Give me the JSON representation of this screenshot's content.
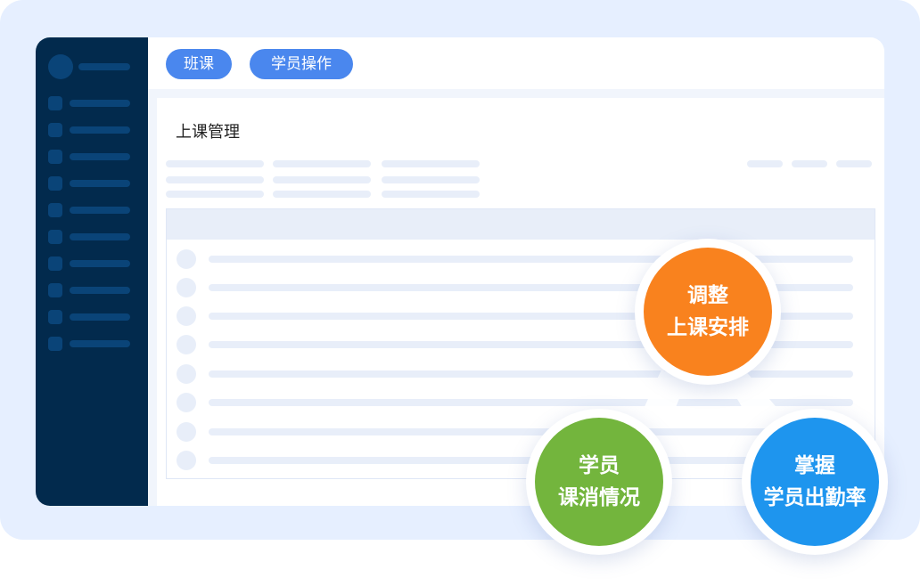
{
  "tabs": [
    {
      "label": "班课"
    },
    {
      "label": "学员操作"
    }
  ],
  "panel": {
    "title": "上课管理"
  },
  "features": [
    {
      "line1": "调整",
      "line2": "上课安排",
      "color": "#f9821e"
    },
    {
      "line1": "学员",
      "line2": "课消情况",
      "color": "#73b53d"
    },
    {
      "line1": "掌握",
      "line2": "学员出勤率",
      "color": "#1e95ee"
    }
  ],
  "colors": {
    "backdrop": "#e6efff",
    "sidebar": "#022a4d",
    "sidebar_placeholder": "#0a4478",
    "accent": "#4a87ee",
    "placeholder": "#e8eef9"
  },
  "icons": [
    "avatar",
    "menu-item-icon",
    "row-checkbox-icon"
  ]
}
